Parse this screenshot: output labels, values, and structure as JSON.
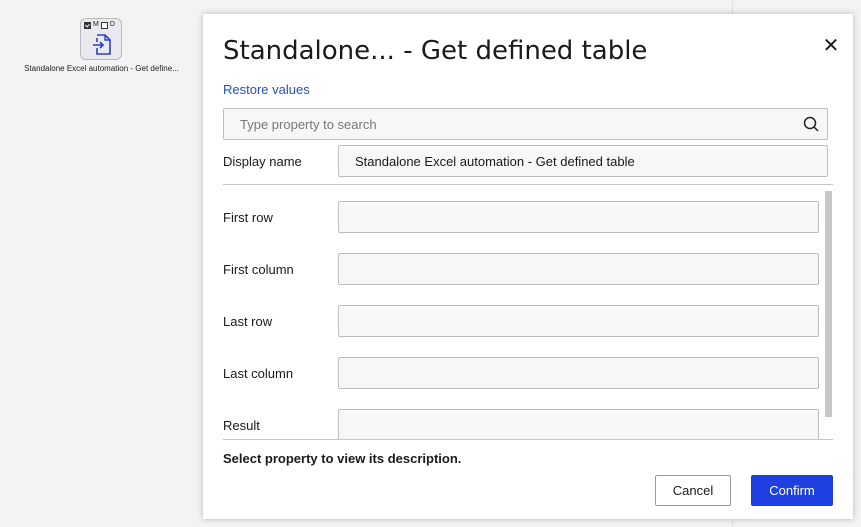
{
  "node": {
    "flags": [
      {
        "label": "",
        "checked": true
      },
      {
        "label": "M",
        "checked": false
      },
      {
        "label": "D",
        "checked": false
      }
    ],
    "icon": "file-import-icon",
    "caption": "Standalone Excel automation - Get define..."
  },
  "dialog": {
    "title": "Standalone... - Get defined table",
    "close_icon": "close-icon",
    "restore_label": "Restore values",
    "search": {
      "placeholder": "Type property to search",
      "value": "",
      "icon": "search-icon"
    },
    "display_name": {
      "label": "Display name",
      "value": "Standalone Excel automation - Get defined table"
    },
    "properties": [
      {
        "label": "First row",
        "value": ""
      },
      {
        "label": "First column",
        "value": ""
      },
      {
        "label": "Last row",
        "value": ""
      },
      {
        "label": "Last column",
        "value": ""
      },
      {
        "label": "Result",
        "value": ""
      }
    ],
    "description": "Select property to view its description.",
    "buttons": {
      "cancel": "Cancel",
      "confirm": "Confirm"
    }
  },
  "colors": {
    "accent": "#1f3fe0",
    "link": "#2850b4"
  }
}
